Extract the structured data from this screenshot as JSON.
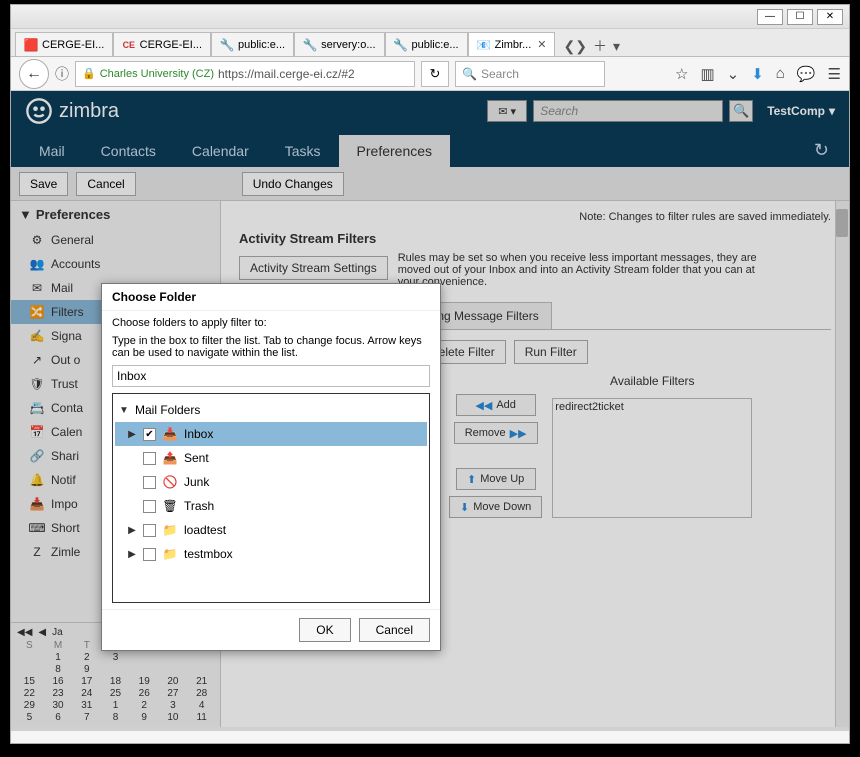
{
  "browser": {
    "tabs": [
      {
        "favicon": "🟥",
        "label": "CERGE-EI..."
      },
      {
        "favicon": "CE",
        "label": "CERGE-EI..."
      },
      {
        "favicon": "🔧",
        "label": "public:e..."
      },
      {
        "favicon": "🔧",
        "label": "servery:o..."
      },
      {
        "favicon": "🔧",
        "label": "public:e..."
      },
      {
        "favicon": "📧",
        "label": "Zimbr..."
      }
    ],
    "activeTab": 5,
    "url_certname": "Charles University (CZ)",
    "url_rest": "https://mail.cerge-ei.cz/#2",
    "search_placeholder": "Search"
  },
  "zimbra": {
    "logo_text": "zimbra",
    "search_placeholder": "Search",
    "user": "TestComp",
    "nav": [
      "Mail",
      "Contacts",
      "Calendar",
      "Tasks",
      "Preferences"
    ],
    "nav_active": 4,
    "save": "Save",
    "cancel": "Cancel",
    "undo": "Undo Changes",
    "side_header": "Preferences",
    "side_items": [
      {
        "icon": "⚙",
        "label": "General"
      },
      {
        "icon": "👥",
        "label": "Accounts"
      },
      {
        "icon": "✉",
        "label": "Mail"
      },
      {
        "icon": "🔀",
        "label": "Filters",
        "selected": true
      },
      {
        "icon": "✍",
        "label": "Signa"
      },
      {
        "icon": "↗",
        "label": "Out o"
      },
      {
        "icon": "🛡",
        "label": "Trust"
      },
      {
        "icon": "📇",
        "label": "Conta"
      },
      {
        "icon": "📅",
        "label": "Calen"
      },
      {
        "icon": "🔗",
        "label": "Shari"
      },
      {
        "icon": "🔔",
        "label": "Notif"
      },
      {
        "icon": "📥",
        "label": "Impo"
      },
      {
        "icon": "⌨",
        "label": "Short"
      },
      {
        "icon": "Z",
        "label": "Zimle"
      }
    ],
    "calendar": {
      "month_label": "Ja",
      "days": [
        "S",
        "M",
        "T",
        "W",
        "T",
        "F",
        "S"
      ],
      "grid": [
        [
          "",
          "1",
          "2",
          "3",
          "",
          "",
          ""
        ],
        [
          "",
          "8",
          "9",
          "",
          "",
          "",
          ""
        ],
        [
          "15",
          "16",
          "17",
          "18",
          "19",
          "20",
          "21"
        ],
        [
          "22",
          "23",
          "24",
          "25",
          "26",
          "27",
          "28"
        ],
        [
          "29",
          "30",
          "31",
          "1",
          "2",
          "3",
          "4"
        ],
        [
          "5",
          "6",
          "7",
          "8",
          "9",
          "10",
          "11"
        ]
      ]
    },
    "note": "Note: Changes to filter rules are saved immediately.",
    "section_title": "Activity Stream Filters",
    "section_desc": "Rules may be set so when you receive less important messages, they are moved out of your Inbox and into an Activity Stream folder that you can at your convenience.",
    "activity_btn": "Activity Stream Settings",
    "subtabs": [
      "",
      "Outgoing Message Filters"
    ],
    "filter_btns": {
      "delete": "Delete Filter",
      "run": "Run Filter",
      "add": "Add",
      "remove": "Remove",
      "moveup": "Move Up",
      "movedown": "Move Down"
    },
    "avail_filters_head": "Available Filters",
    "avail_filters": [
      "redirect2ticket"
    ]
  },
  "modal": {
    "title": "Choose Folder",
    "instr1": "Choose folders to apply filter to:",
    "instr2": "Type in the box to filter the list. Tab to change focus. Arrow keys can be used to navigate within the list.",
    "input_value": "Inbox",
    "root": "Mail Folders",
    "folders": [
      {
        "expand": "▶",
        "checked": true,
        "icon": "📥",
        "label": "Inbox",
        "selected": true
      },
      {
        "expand": "",
        "checked": false,
        "icon": "📤",
        "label": "Sent"
      },
      {
        "expand": "",
        "checked": false,
        "icon": "🚫",
        "label": "Junk"
      },
      {
        "expand": "",
        "checked": false,
        "icon": "🗑",
        "label": "Trash"
      },
      {
        "expand": "▶",
        "checked": false,
        "icon": "📁",
        "label": "loadtest"
      },
      {
        "expand": "▶",
        "checked": false,
        "icon": "📁",
        "label": "testmbox"
      }
    ],
    "ok": "OK",
    "cancel": "Cancel"
  }
}
